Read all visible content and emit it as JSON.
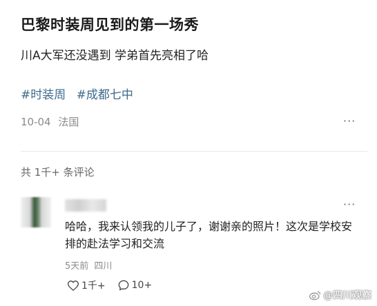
{
  "post": {
    "title": "巴黎时装周见到的第一场秀",
    "body": "川A大军还没遇到 学弟首先亮相了哈",
    "hashtags": [
      "#时装周",
      "#成都七中"
    ],
    "date": "10-04",
    "location": "法国",
    "more_label": "···"
  },
  "comments_section": {
    "count_label": "共 1千+ 条评论"
  },
  "comment": {
    "text": "哈哈，我来认领我的儿子了，谢谢亲的照片！这次是学校安排的赴法学习和交流",
    "time": "5天前",
    "location": "四川",
    "likes": "1千+",
    "replies": "10+",
    "more_label": "···"
  },
  "watermark": {
    "text": "@四川观察"
  }
}
